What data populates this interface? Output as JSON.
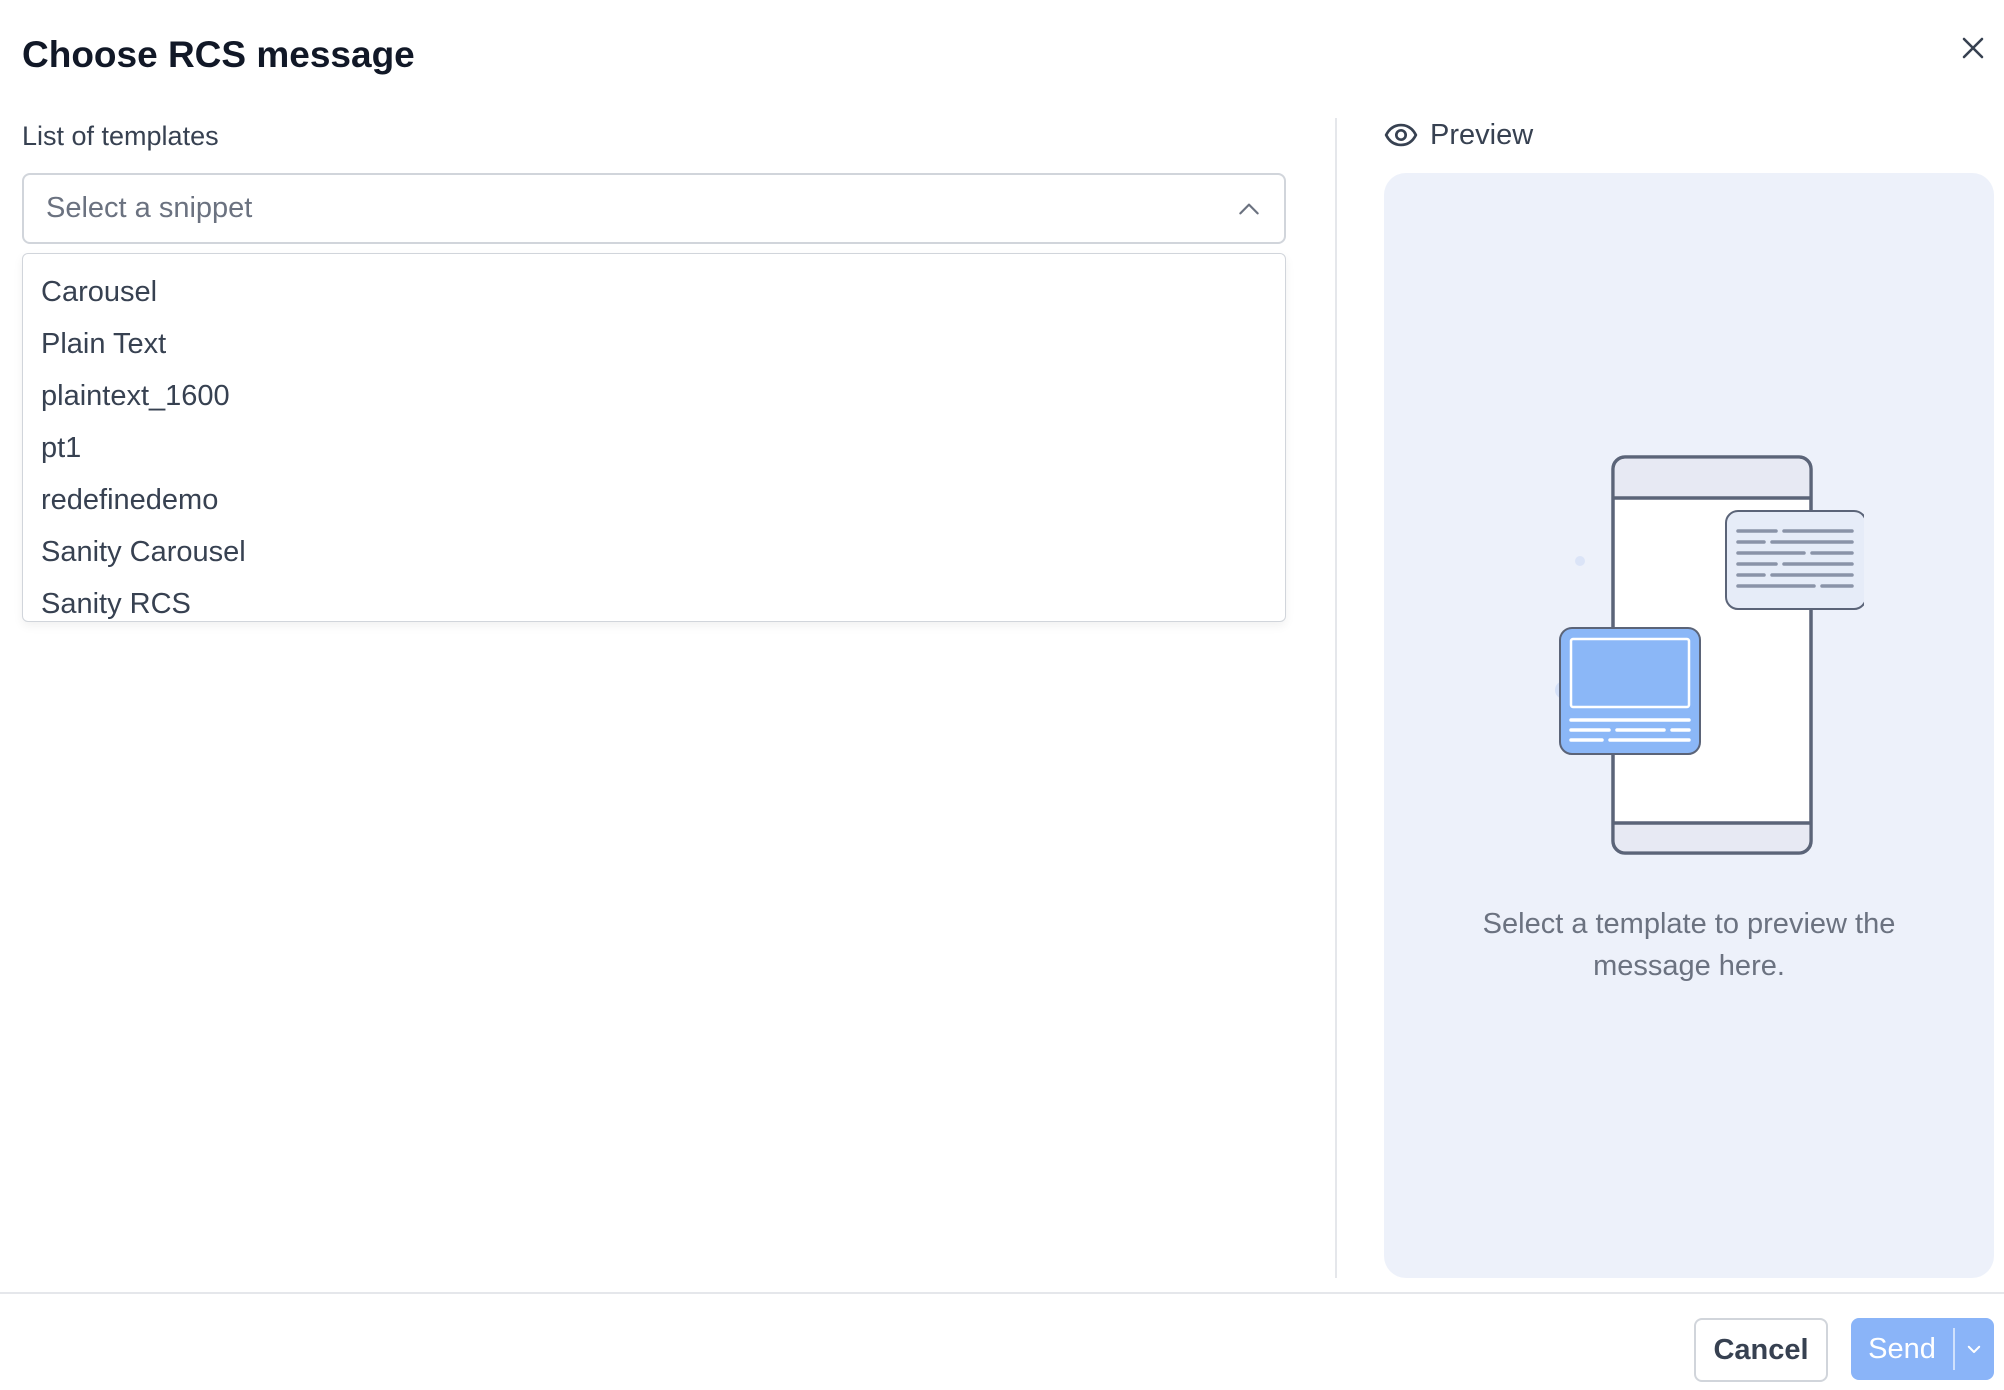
{
  "dialog": {
    "title": "Choose RCS message"
  },
  "templates": {
    "label": "List of templates",
    "placeholder": "Select a snippet",
    "options": [
      "Carousel",
      "Plain Text",
      "plaintext_1600",
      "pt1",
      "redefinedemo",
      "Sanity Carousel",
      "Sanity RCS"
    ]
  },
  "preview": {
    "label": "Preview",
    "empty_line1": "Select a template to preview the",
    "empty_line2": "message here."
  },
  "footer": {
    "cancel_label": "Cancel",
    "send_label": "Send"
  },
  "colors": {
    "accent": "#8ab4f8",
    "panel_bg": "#edf1fa",
    "border": "#d1d5db"
  },
  "icons": {
    "close": "close-icon",
    "select_toggle": "chevron-up-icon",
    "preview": "eye-icon",
    "send_dropdown": "chevron-down-icon"
  }
}
